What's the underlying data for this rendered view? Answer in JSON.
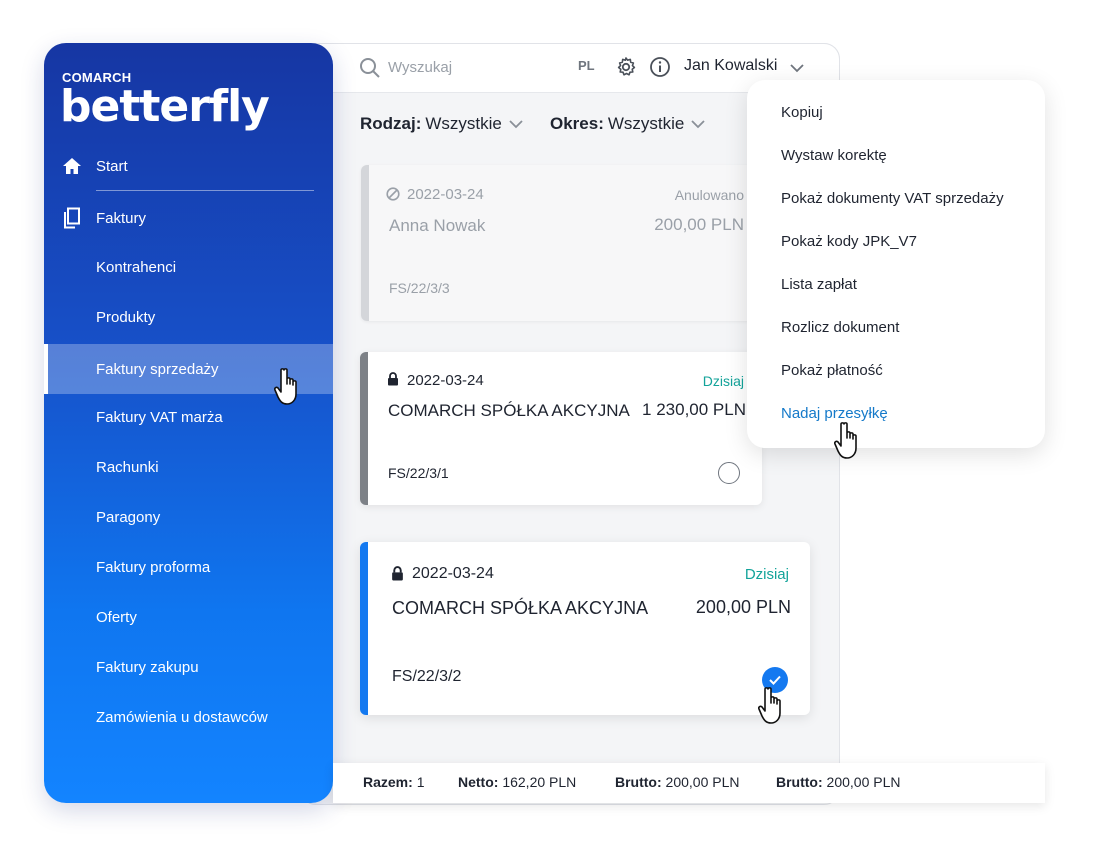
{
  "sidebar": {
    "brand_small": "COMARCH",
    "brand_big": "betterfly",
    "items": [
      {
        "label": "Start",
        "icon": "home-icon"
      },
      {
        "label": "Faktury",
        "icon": "documents-icon"
      },
      {
        "label": "Kontrahenci"
      },
      {
        "label": "Produkty"
      },
      {
        "label": "Faktury sprzedaży",
        "active": true
      },
      {
        "label": "Faktury VAT marża"
      },
      {
        "label": "Rachunki"
      },
      {
        "label": "Paragony"
      },
      {
        "label": "Faktury proforma"
      },
      {
        "label": "Oferty"
      },
      {
        "label": "Faktury zakupu"
      },
      {
        "label": "Zamówienia u dostawców"
      }
    ]
  },
  "topbar": {
    "search_placeholder": "Wyszukaj",
    "language": "PL",
    "user_name": "Jan Kowalski"
  },
  "filters": {
    "kind_label": "Rodzaj:",
    "kind_value": "Wszystkie",
    "period_label": "Okres:",
    "period_value": "Wszystkie"
  },
  "documents": [
    {
      "date": "2022-03-24",
      "status": "Anulowano",
      "name": "Anna Nowak",
      "amount": "200,00 PLN",
      "number": "FS/22/3/3",
      "state": "cancelled"
    },
    {
      "date": "2022-03-24",
      "status": "Dzisiaj",
      "name": "COMARCH SPÓŁKA AKCYJNA",
      "amount": "1 230,00 PLN",
      "number": "FS/22/3/1",
      "state": "locked",
      "checked": false
    },
    {
      "date": "2022-03-24",
      "status": "Dzisiaj",
      "name": "COMARCH SPÓŁKA AKCYJNA",
      "amount": "200,00 PLN",
      "number": "FS/22/3/2",
      "state": "locked",
      "checked": true
    }
  ],
  "context_menu": {
    "items": [
      "Kopiuj",
      "Wystaw korektę",
      "Pokaż dokumenty VAT sprzedaży",
      "Pokaż kody JPK_V7",
      "Lista zapłat",
      "Rozlicz dokument",
      "Pokaż płatność",
      "Nadaj przesyłkę"
    ],
    "highlighted": "Nadaj przesyłkę"
  },
  "footer": {
    "total_label": "Razem:",
    "total_value": "1",
    "net_label": "Netto:",
    "net_value": "162,20 PLN",
    "gross_label": "Brutto:",
    "gross_value": "200,00 PLN",
    "gross2_label": "Brutto:",
    "gross2_value": "200,00 PLN"
  },
  "colors": {
    "accent": "#1479f0",
    "status_today": "#13a39a",
    "link": "#1479c9",
    "sidebar_top": "#1636a3",
    "sidebar_bottom": "#1384ff"
  }
}
